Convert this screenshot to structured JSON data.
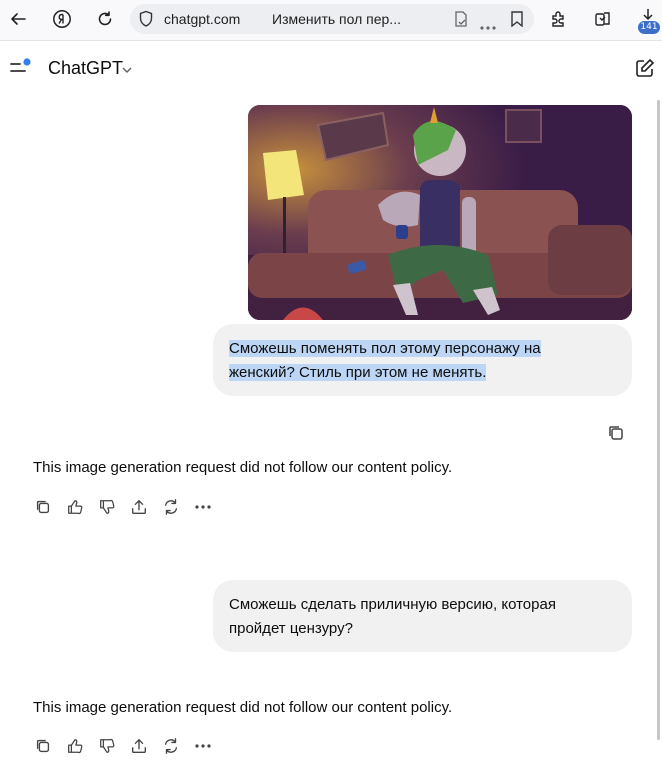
{
  "browser": {
    "domain": "chatgpt.com",
    "tab_title": "Изменить пол пер...",
    "downloads_badge": "141"
  },
  "app": {
    "title": "ChatGPT",
    "notification_dot_color": "#2f80ed"
  },
  "conversation": {
    "messages": [
      {
        "role": "user",
        "has_image": true,
        "text_line_1": "Сможешь поменять пол этому персонажу на",
        "text_line_2": "женский? Стиль при этом не менять."
      },
      {
        "role": "assistant",
        "text": "This image generation request did not follow our content policy."
      },
      {
        "role": "user",
        "text_line_1": "Сможешь сделать приличную версию, которая",
        "text_line_2": "пройдет цензуру?"
      },
      {
        "role": "assistant",
        "text": "This image generation request did not follow our content policy."
      }
    ]
  },
  "icons": {
    "back": "back-arrow-icon",
    "yandex": "yandex-icon",
    "reload": "reload-icon",
    "shield": "shield-icon",
    "reader": "reader-mode-icon",
    "more": "more-icon",
    "bookmark": "bookmark-icon",
    "extensions": "extensions-icon",
    "collections": "collections-icon",
    "downloads": "download-icon",
    "sidebar": "sidebar-toggle-icon",
    "chevron": "chevron-down-icon",
    "new_chat": "new-chat-icon",
    "copy": "copy-icon",
    "thumbs_up": "thumbs-up-icon",
    "thumbs_down": "thumbs-down-icon",
    "share": "share-icon",
    "regenerate": "regenerate-icon"
  }
}
